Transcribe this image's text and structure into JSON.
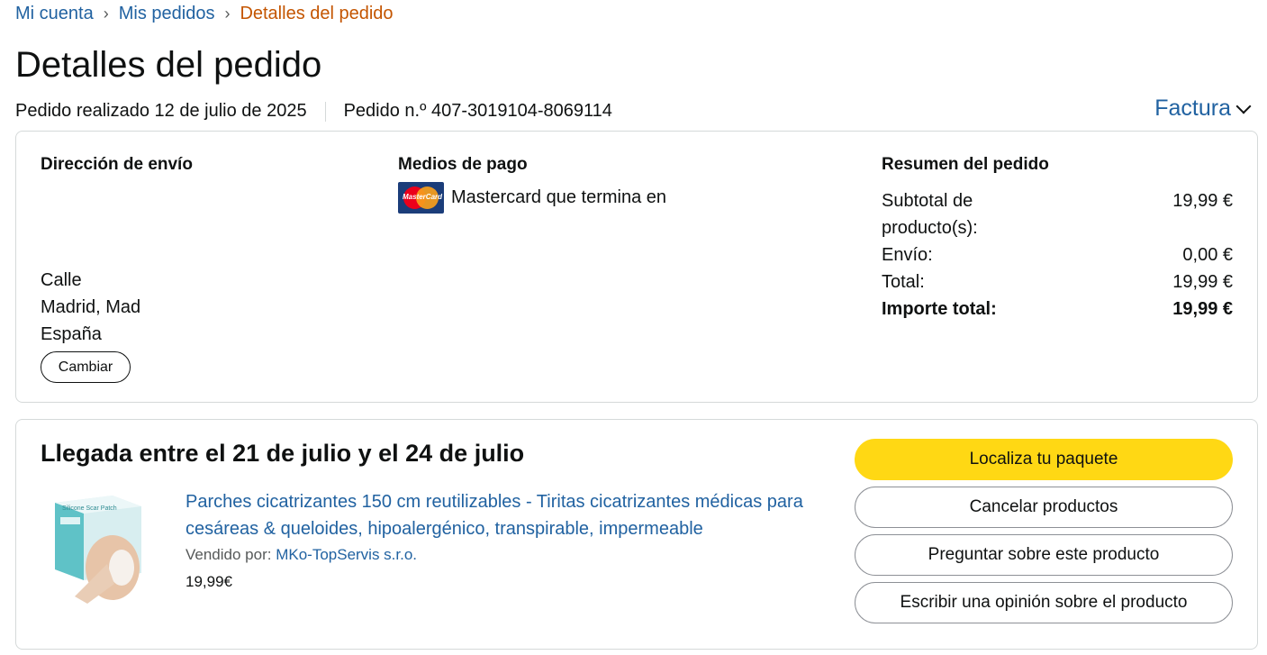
{
  "breadcrumb": {
    "items": [
      "Mi cuenta",
      "Mis pedidos"
    ],
    "separator": "›",
    "current": "Detalles del pedido"
  },
  "page_title": "Detalles del pedido",
  "order_meta": {
    "placed": "Pedido realizado 12 de julio de 2025",
    "number": "Pedido n.º 407-3019104-8069114"
  },
  "invoice_label": "Factura",
  "shipping": {
    "heading": "Dirección de envío",
    "lines": [
      "Calle",
      "Madrid, Mad",
      "España"
    ],
    "change_button": "Cambiar"
  },
  "payment": {
    "heading": "Medios de pago",
    "card_logo_text": "MasterCard",
    "method": "Mastercard  que termina en"
  },
  "summary": {
    "heading": "Resumen del pedido",
    "rows": [
      {
        "label": "Subtotal de producto(s):",
        "value": "19,99 €"
      },
      {
        "label": "Envío:",
        "value": "0,00 €"
      },
      {
        "label": "Total:",
        "value": "19,99 €"
      },
      {
        "label": "Importe total:",
        "value": "19,99 €"
      }
    ]
  },
  "shipment": {
    "arrival": "Llegada entre el 21 de julio y el 24 de julio",
    "product_title": "Parches cicatrizantes 150 cm reutilizables - Tiritas cicatrizantes médicas para cesáreas & queloides, hipoalergénico, transpirable, impermeable",
    "sold_by_label": "Vendido por:",
    "seller": "MKo-TopServis s.r.o.",
    "price": "19,99€",
    "image_label": "Silicone Scar Patch",
    "actions": {
      "track": "Localiza tu paquete",
      "cancel": "Cancelar productos",
      "ask": "Preguntar sobre este producto",
      "review": "Escribir una opinión sobre el producto"
    }
  },
  "colors": {
    "link": "#2162a1",
    "current_crumb": "#c45500",
    "primary_button": "#ffd814",
    "border": "#d5d9d9"
  }
}
